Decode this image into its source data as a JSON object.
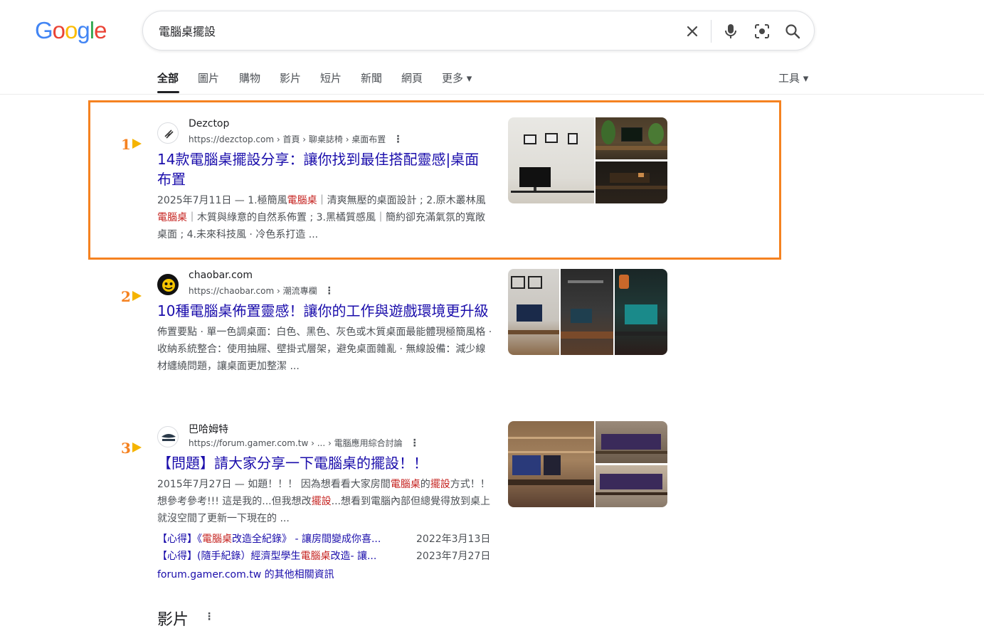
{
  "logo": {
    "letters": [
      "G",
      "o",
      "o",
      "g",
      "l",
      "e"
    ],
    "colors": [
      "#4285f4",
      "#ea4335",
      "#fbbc05",
      "#4285f4",
      "#34a853",
      "#ea4335"
    ]
  },
  "search": {
    "query": "電腦桌擺設"
  },
  "icons": {
    "clear": "close-icon",
    "voice": "microphone-icon",
    "lens": "camera-lens-icon",
    "search": "search-icon"
  },
  "tabs": [
    {
      "label": "全部",
      "active": true
    },
    {
      "label": "圖片"
    },
    {
      "label": "購物"
    },
    {
      "label": "影片"
    },
    {
      "label": "短片"
    },
    {
      "label": "新聞"
    },
    {
      "label": "網頁"
    },
    {
      "label": "更多 ▾"
    }
  ],
  "tools_label": "工具 ▾",
  "highlight_color": "#f58220",
  "results": [
    {
      "marker": "1",
      "site_name": "Dezctop",
      "site_url": "https://dezctop.com › 首頁 › 聊桌誌椅 › 桌面布置",
      "title": "14款電腦桌擺設分享：讓你找到最佳搭配靈感|桌面布置",
      "snippet_parts": [
        {
          "t": "2025年7月11日 — 1.極簡風"
        },
        {
          "t": "電腦桌",
          "hl": true
        },
        {
          "t": "｜清爽無壓的桌面設計 ; 2.原木叢林風"
        },
        {
          "t": "電腦桌",
          "hl": true
        },
        {
          "t": "｜木質與綠意的自然系佈置 ; 3.黑橘質感風｜簡約卻充滿氣氛的寬敞桌面 ; 4.未來科技風 · 冷色系打造 ..."
        }
      ]
    },
    {
      "marker": "2",
      "site_name": "chaobar.com",
      "site_url": "https://chaobar.com › 潮流專欄",
      "title": "10種電腦桌佈置靈感！讓你的工作與遊戲環境更升級",
      "snippet_parts": [
        {
          "t": "佈置要點 · 單一色調桌面：白色、黑色、灰色或木質桌面最能體現極簡風格 · 收納系統整合：使用抽屜、壁掛式層架，避免桌面雜亂 · 無線設備：減少線材纏繞問題，讓桌面更加整潔 ..."
        }
      ]
    },
    {
      "marker": "3",
      "site_name": "巴哈姆特",
      "site_url": "https://forum.gamer.com.tw › ... › 電腦應用綜合討論",
      "title": "【問題】請大家分享一下電腦桌的擺設！！",
      "snippet_parts": [
        {
          "t": "2015年7月27日 — 如題！！！ 因為想看看大家房間"
        },
        {
          "t": "電腦桌",
          "hl": true
        },
        {
          "t": "的"
        },
        {
          "t": "擺設",
          "hl": true
        },
        {
          "t": "方式！！想參考參考!!! 這是我的...但我想改"
        },
        {
          "t": "擺設",
          "hl": true
        },
        {
          "t": "...想看到電腦內部但總覺得放到桌上就沒空間了更新一下現在的 ..."
        }
      ],
      "sublinks": [
        {
          "parts": [
            {
              "t": "【心得】《"
            },
            {
              "t": "電腦桌",
              "hl": true
            },
            {
              "t": "改造全紀錄》 - 讓房間變成你喜..."
            }
          ],
          "date": "2022年3月13日"
        },
        {
          "parts": [
            {
              "t": "【心得】(隨手紀錄）經濟型學生"
            },
            {
              "t": "電腦桌",
              "hl": true
            },
            {
              "t": "改造- 讓..."
            }
          ],
          "date": "2023年7月27日"
        }
      ],
      "more_link": "forum.gamer.com.tw 的其他相關資訊"
    }
  ],
  "section": {
    "title": "影片"
  }
}
